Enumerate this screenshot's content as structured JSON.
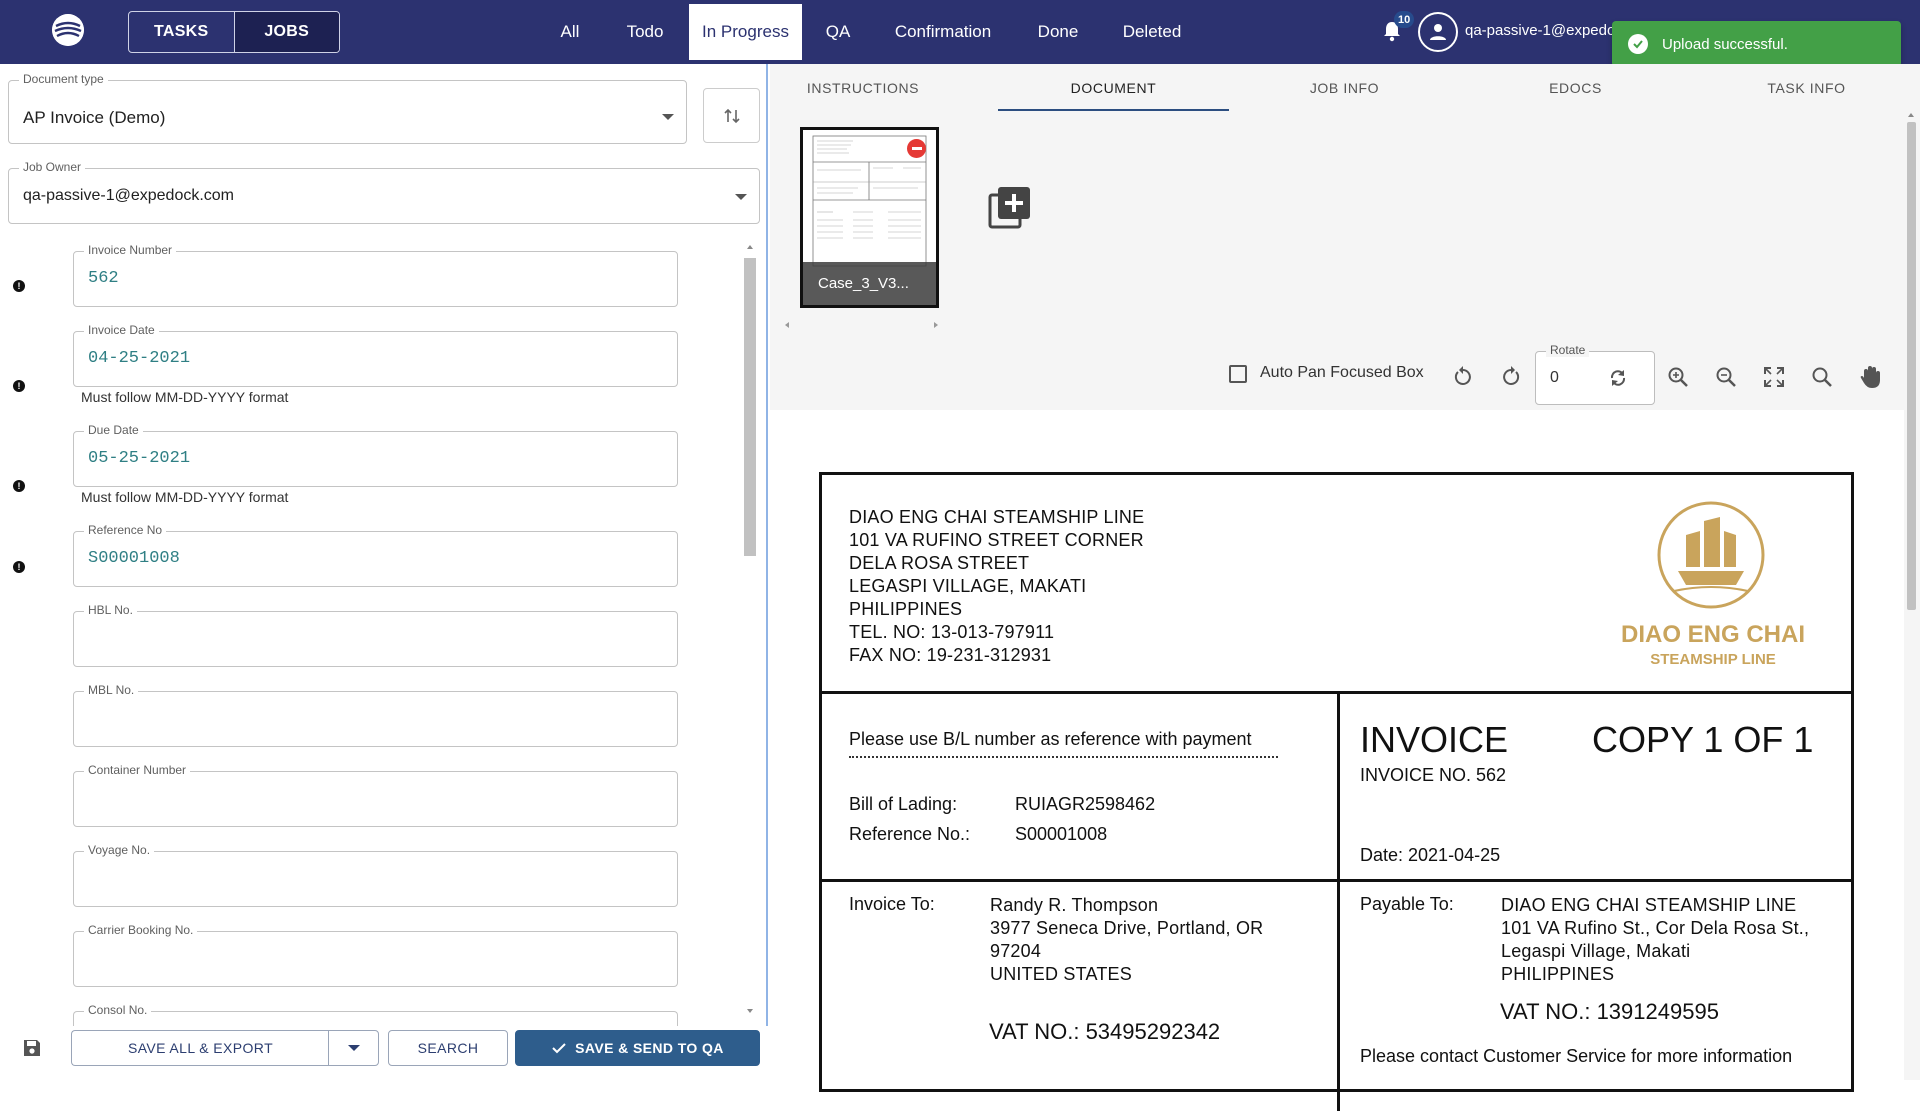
{
  "topbar": {
    "mode_tabs": [
      "TASKS",
      "JOBS"
    ],
    "status_tabs": [
      "All",
      "Todo",
      "In Progress",
      "QA",
      "Confirmation",
      "Done",
      "Deleted"
    ],
    "active_status_tab": "In Progress",
    "notification_count": "10",
    "user_email": "qa-passive-1@expedock.com"
  },
  "toast": {
    "message": "Upload successful."
  },
  "left": {
    "document_type": {
      "label": "Document type",
      "value": "AP Invoice (Demo)"
    },
    "job_owner": {
      "label": "Job Owner",
      "value": "qa-passive-1@expedock.com"
    },
    "fields": [
      {
        "label": "Invoice Number",
        "value": "562",
        "helper": "",
        "warning": true
      },
      {
        "label": "Invoice Date",
        "value": "04-25-2021",
        "helper": "Must follow MM-DD-YYYY format",
        "warning": true
      },
      {
        "label": "Due Date",
        "value": "05-25-2021",
        "helper": "Must follow MM-DD-YYYY format",
        "warning": true
      },
      {
        "label": "Reference No",
        "value": "S00001008",
        "helper": "",
        "warning": true
      },
      {
        "label": "HBL No.",
        "value": ""
      },
      {
        "label": "MBL No.",
        "value": ""
      },
      {
        "label": "Container Number",
        "value": ""
      },
      {
        "label": "Voyage No.",
        "value": ""
      },
      {
        "label": "Carrier Booking No.",
        "value": ""
      },
      {
        "label": "Consol No.",
        "value": ""
      }
    ],
    "buttons": {
      "save_all_export": "SAVE ALL & EXPORT",
      "search": "SEARCH",
      "save_send_qa": "SAVE & SEND TO QA"
    }
  },
  "right": {
    "tabs": [
      "INSTRUCTIONS",
      "DOCUMENT",
      "JOB INFO",
      "EDOCS",
      "TASK INFO"
    ],
    "active_tab": "DOCUMENT",
    "thumbnail_caption": "Case_3_V3...",
    "toolbar": {
      "auto_pan_label": "Auto Pan Focused Box",
      "auto_pan_checked": false,
      "rotate_label": "Rotate",
      "rotate_value": "0"
    }
  },
  "invoice": {
    "company_lines": [
      "DIAO ENG CHAI STEAMSHIP LINE",
      "101 VA RUFINO STREET CORNER",
      "DELA ROSA STREET",
      "LEGASPI VILLAGE, MAKATI",
      "PHILIPPINES",
      "TEL. NO: 13-013-797911",
      "FAX NO: 19-231-312931"
    ],
    "logo_name": "DIAO ENG CHAI",
    "logo_sub": "STEAMSHIP LINE",
    "reference_note": "Please use B/L number as reference with payment",
    "bol_label": "Bill of Lading:",
    "bol_value": "RUIAGR2598462",
    "ref_label": "Reference No.:",
    "ref_value": "S00001008",
    "title": "INVOICE",
    "copy": "COPY 1 OF 1",
    "invoice_no": "INVOICE NO. 562",
    "date": "Date: 2021-04-25",
    "invoice_to_label": "Invoice To:",
    "invoice_to_lines": [
      "Randy R. Thompson",
      "3977 Seneca Drive, Portland, OR",
      "97204",
      "UNITED STATES"
    ],
    "invoice_to_vat": "VAT NO.: 53495292342",
    "payable_to_label": "Payable To:",
    "payable_to_lines": [
      "DIAO ENG CHAI STEAMSHIP LINE",
      "101 VA Rufino St., Cor Dela Rosa St.,",
      "Legaspi Village, Makati",
      "PHILIPPINES"
    ],
    "payable_to_vat": "VAT NO.: 1391249595",
    "contact_note": "Please contact Customer Service for more information"
  },
  "colors": {
    "nav": "#2c3270",
    "toast": "#43a047",
    "primary_button": "#2e5d8c",
    "field_value": "#2f7f84",
    "logo_gold": "#c9a45c"
  }
}
